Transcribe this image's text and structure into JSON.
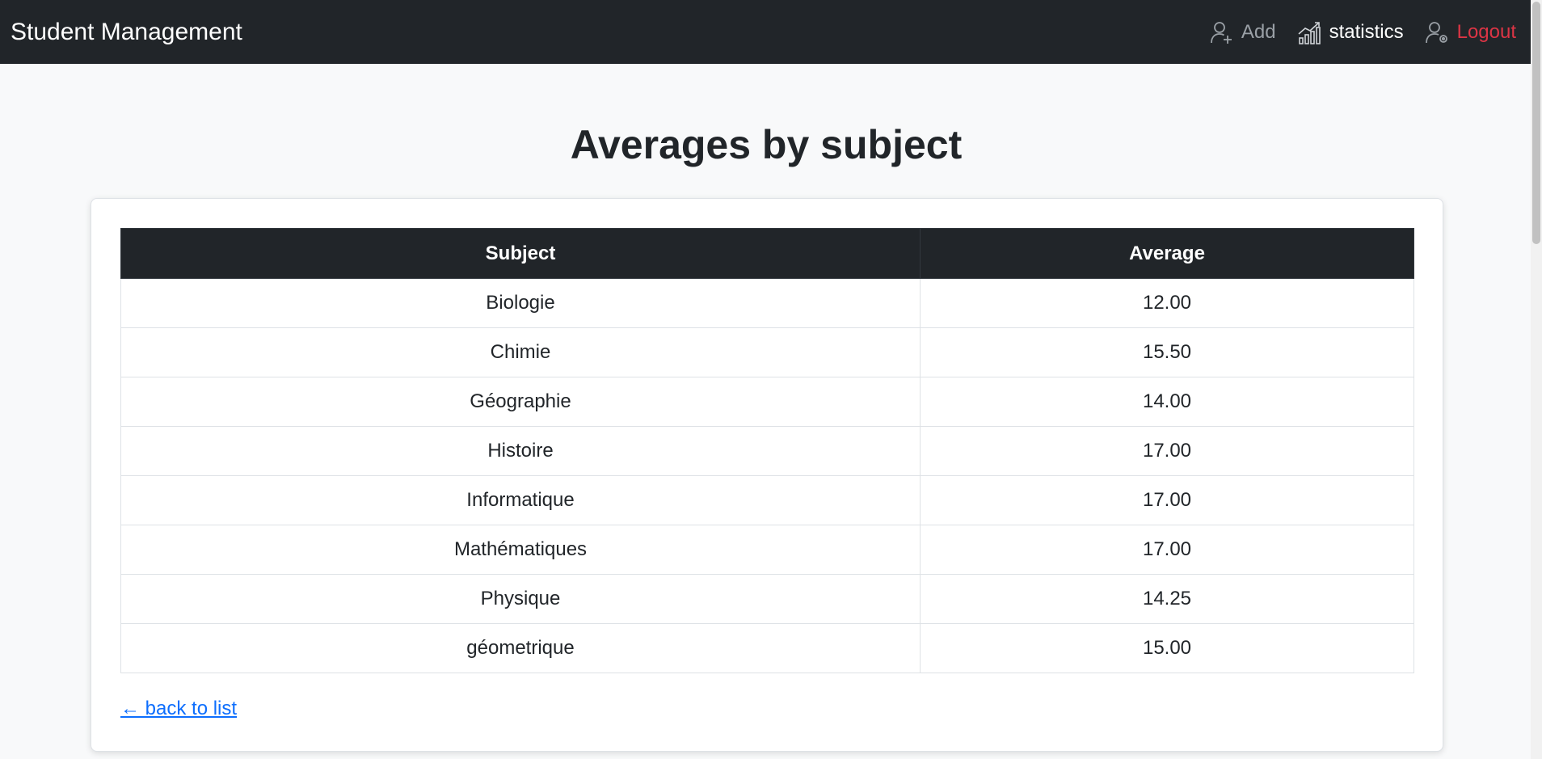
{
  "navbar": {
    "brand": "Student Management",
    "add_label": "Add",
    "statistics_label": "statistics",
    "logout_label": "Logout"
  },
  "page": {
    "title": "Averages by subject"
  },
  "table": {
    "headers": [
      "Subject",
      "Average"
    ],
    "rows": [
      {
        "subject": "Biologie",
        "average": "12.00"
      },
      {
        "subject": "Chimie",
        "average": "15.50"
      },
      {
        "subject": "Géographie",
        "average": "14.00"
      },
      {
        "subject": "Histoire",
        "average": "17.00"
      },
      {
        "subject": "Informatique",
        "average": "17.00"
      },
      {
        "subject": "Mathématiques",
        "average": "17.00"
      },
      {
        "subject": "Physique",
        "average": "14.25"
      },
      {
        "subject": "géometrique",
        "average": "15.00"
      }
    ]
  },
  "back_link": "← back to list",
  "colors": {
    "navbar_bg": "#212529",
    "logout": "#dc3545",
    "link": "#0d6efd",
    "page_bg": "#f8f9fa"
  }
}
